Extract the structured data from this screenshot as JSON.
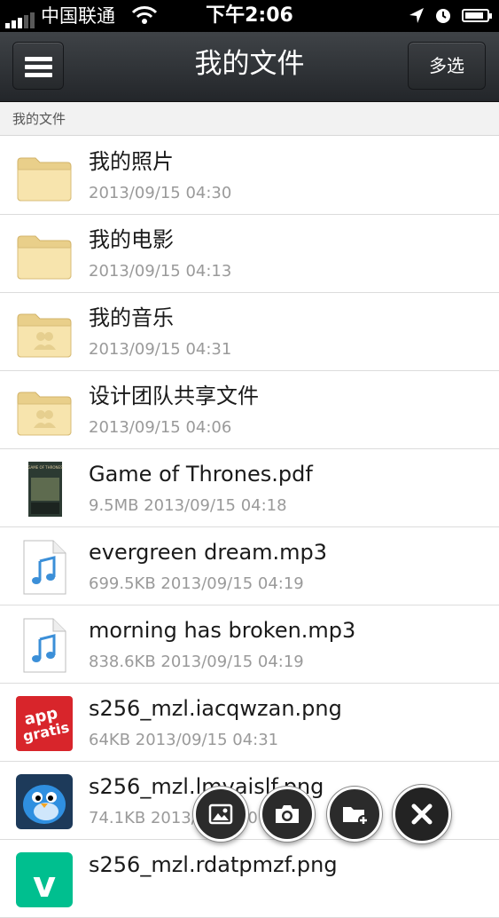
{
  "status_bar": {
    "carrier": "中国联通",
    "time": "下午2:06",
    "battery_level": 0.85
  },
  "navbar": {
    "title": "我的文件",
    "multi_select_label": "多选"
  },
  "breadcrumb": "我的文件",
  "files": [
    {
      "name": "我的照片",
      "meta": "2013/09/15 04:30",
      "icon": "folder-icon"
    },
    {
      "name": "我的电影",
      "meta": "2013/09/15 04:13",
      "icon": "folder-icon"
    },
    {
      "name": "我的音乐",
      "meta": "2013/09/15 04:31",
      "icon": "shared-folder-icon"
    },
    {
      "name": "设计团队共享文件",
      "meta": "2013/09/15 04:06",
      "icon": "shared-folder-icon"
    },
    {
      "name": "Game of Thrones.pdf",
      "meta": "9.5MB 2013/09/15 04:18",
      "icon": "pdf-thumbnail"
    },
    {
      "name": "evergreen dream.mp3",
      "meta": "699.5KB 2013/09/15 04:19",
      "icon": "music-file-icon"
    },
    {
      "name": "morning has broken.mp3",
      "meta": "838.6KB 2013/09/15 04:19",
      "icon": "music-file-icon"
    },
    {
      "name": "s256_mzl.iacqwzan.png",
      "meta": "64KB 2013/09/15 04:31",
      "icon": "image-thumbnail"
    },
    {
      "name": "s256_mzl.lmvaislf.png",
      "meta": "74.1KB 2013/09/15 0",
      "icon": "image-thumbnail"
    },
    {
      "name": "s256_mzl.rdatpmzf.png",
      "meta": "",
      "icon": "image-thumbnail"
    }
  ],
  "thumbnail_text": {
    "pdf": "GAME OF THRONES",
    "appgratis": [
      "app",
      "gratis"
    ],
    "vine": "v"
  },
  "fab_actions": [
    {
      "icon": "image-upload-icon"
    },
    {
      "icon": "camera-icon"
    },
    {
      "icon": "new-folder-icon"
    },
    {
      "icon": "close-icon"
    }
  ],
  "colors": {
    "navbar": "#2f3236",
    "folder": "#f5dfa2",
    "music": "#3b8fd8",
    "appgratis": "#d8252b",
    "twitterbird": "#2f8fe0",
    "vine": "#00bf8f"
  }
}
